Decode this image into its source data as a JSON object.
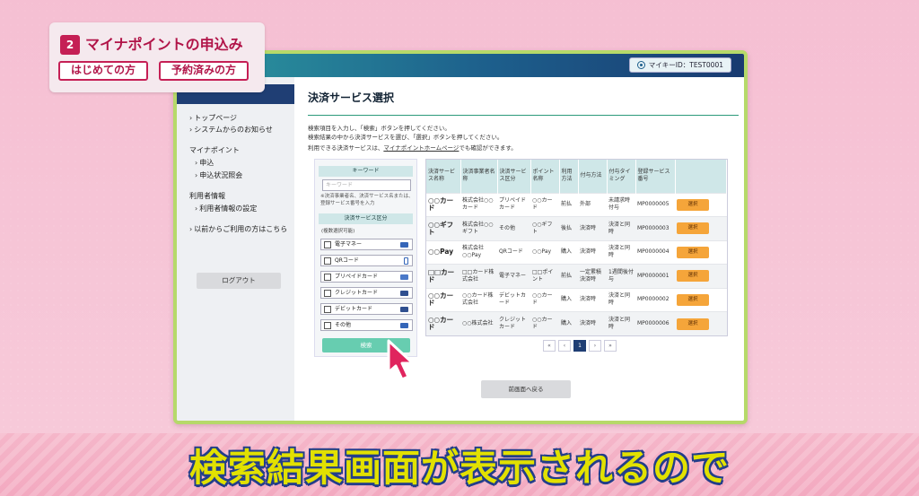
{
  "overlay": {
    "step_number": "2",
    "step_title": "マイナポイントの申込み",
    "tags": [
      "はじめての方",
      "予約済みの方"
    ]
  },
  "header": {
    "user_id": "マイキーID：TEST0001"
  },
  "sidebar": {
    "items": [
      "トップページ",
      "システムからのお知らせ",
      "マイナポイント",
      "申込",
      "申込状況照会",
      "利用者情報",
      "利用者情報の設定",
      "以前からご利用の方はこちら"
    ],
    "logout": "ログアウト"
  },
  "main": {
    "title": "決済サービス選択",
    "intro": [
      "検索項目を入力し、「検索」ボタンを押してください。",
      "検索結果の中から決済サービスを選び、「選択」ボタンを押してください。"
    ],
    "intro_prefix": "利用できる決済サービスは、",
    "intro_link": "マイナポイントホームページ",
    "intro_suffix": "でも確認ができます。"
  },
  "search": {
    "keyword_header": "キーワード",
    "keyword_placeholder": "キーワード",
    "keyword_note": "※決済事業者名、決済サービス名または、登録サービス番号を入力",
    "type_header": "決済サービス区分",
    "multi_note": "(複数選択可能)",
    "types": [
      "電子マネー",
      "QRコード",
      "プリペイドカード",
      "クレジットカード",
      "デビットカード",
      "その他"
    ],
    "button": "検索"
  },
  "results": {
    "headers": [
      "決済サービス名称",
      "決済事業者名称",
      "決済サービス区分",
      "ポイント名称",
      "利用方法",
      "付与方法",
      "付与タイミング",
      "登録サービス番号",
      ""
    ],
    "rows": [
      [
        "○○カード",
        "株式会社○○カード",
        "プリペイドカード",
        "○○カード",
        "前払",
        "外部",
        "未請求時付与",
        "MP0000005",
        "選択"
      ],
      [
        "○○ギフト",
        "株式会社○○ギフト",
        "その他",
        "○○ギフト",
        "後払",
        "決済時",
        "決済と同時",
        "MP0000003",
        "選択"
      ],
      [
        "○○Pay",
        "株式会社○○Pay",
        "QRコード",
        "○○Pay",
        "購入",
        "決済時",
        "決済と同時",
        "MP0000004",
        "選択"
      ],
      [
        "□□カード",
        "□□カード株式会社",
        "電子マネー",
        "□□ポイント",
        "前払",
        "一定累積決済時",
        "1週間後付与",
        "MP0000001",
        "選択"
      ],
      [
        "○○カード",
        "○○カード株式会社",
        "デビットカード",
        "○○カード",
        "購入",
        "決済時",
        "決済と同時",
        "MP0000002",
        "選択"
      ],
      [
        "○○カード",
        "○○株式会社",
        "クレジットカード",
        "○○カード",
        "購入",
        "決済時",
        "決済と同時",
        "MP0000006",
        "選択"
      ]
    ],
    "pager": [
      "«",
      "‹",
      "1",
      "›",
      "»"
    ],
    "back": "前画面へ戻る"
  },
  "caption": "検索結果画面が表示されるので",
  "colors": {
    "accent": "#c51f55",
    "frame": "#b6d96a",
    "select_button": "#f5a53a",
    "search_button": "#67cdb0",
    "nav_dark": "#1f3e74",
    "caption_fill": "#e2e100",
    "caption_stroke": "#233e8a"
  }
}
